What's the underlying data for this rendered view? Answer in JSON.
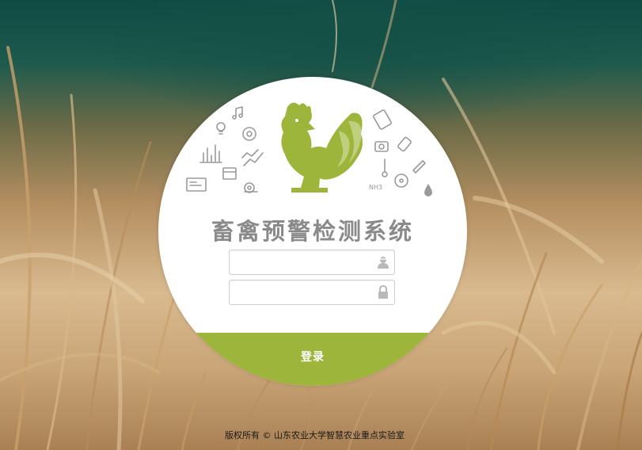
{
  "login": {
    "system_title": "畜禽预警检测系统",
    "username": {
      "value": "",
      "placeholder": "",
      "icon": "user-icon"
    },
    "password": {
      "value": "",
      "placeholder": "",
      "icon": "lock-icon"
    },
    "submit_label": "登录"
  },
  "footer": {
    "copyright": "版权所有 © 山东农业大学智慧农业重点实验室"
  },
  "colors": {
    "accent": "#9db53a",
    "logo": "#9db53a",
    "title": "#8a8a8a"
  }
}
